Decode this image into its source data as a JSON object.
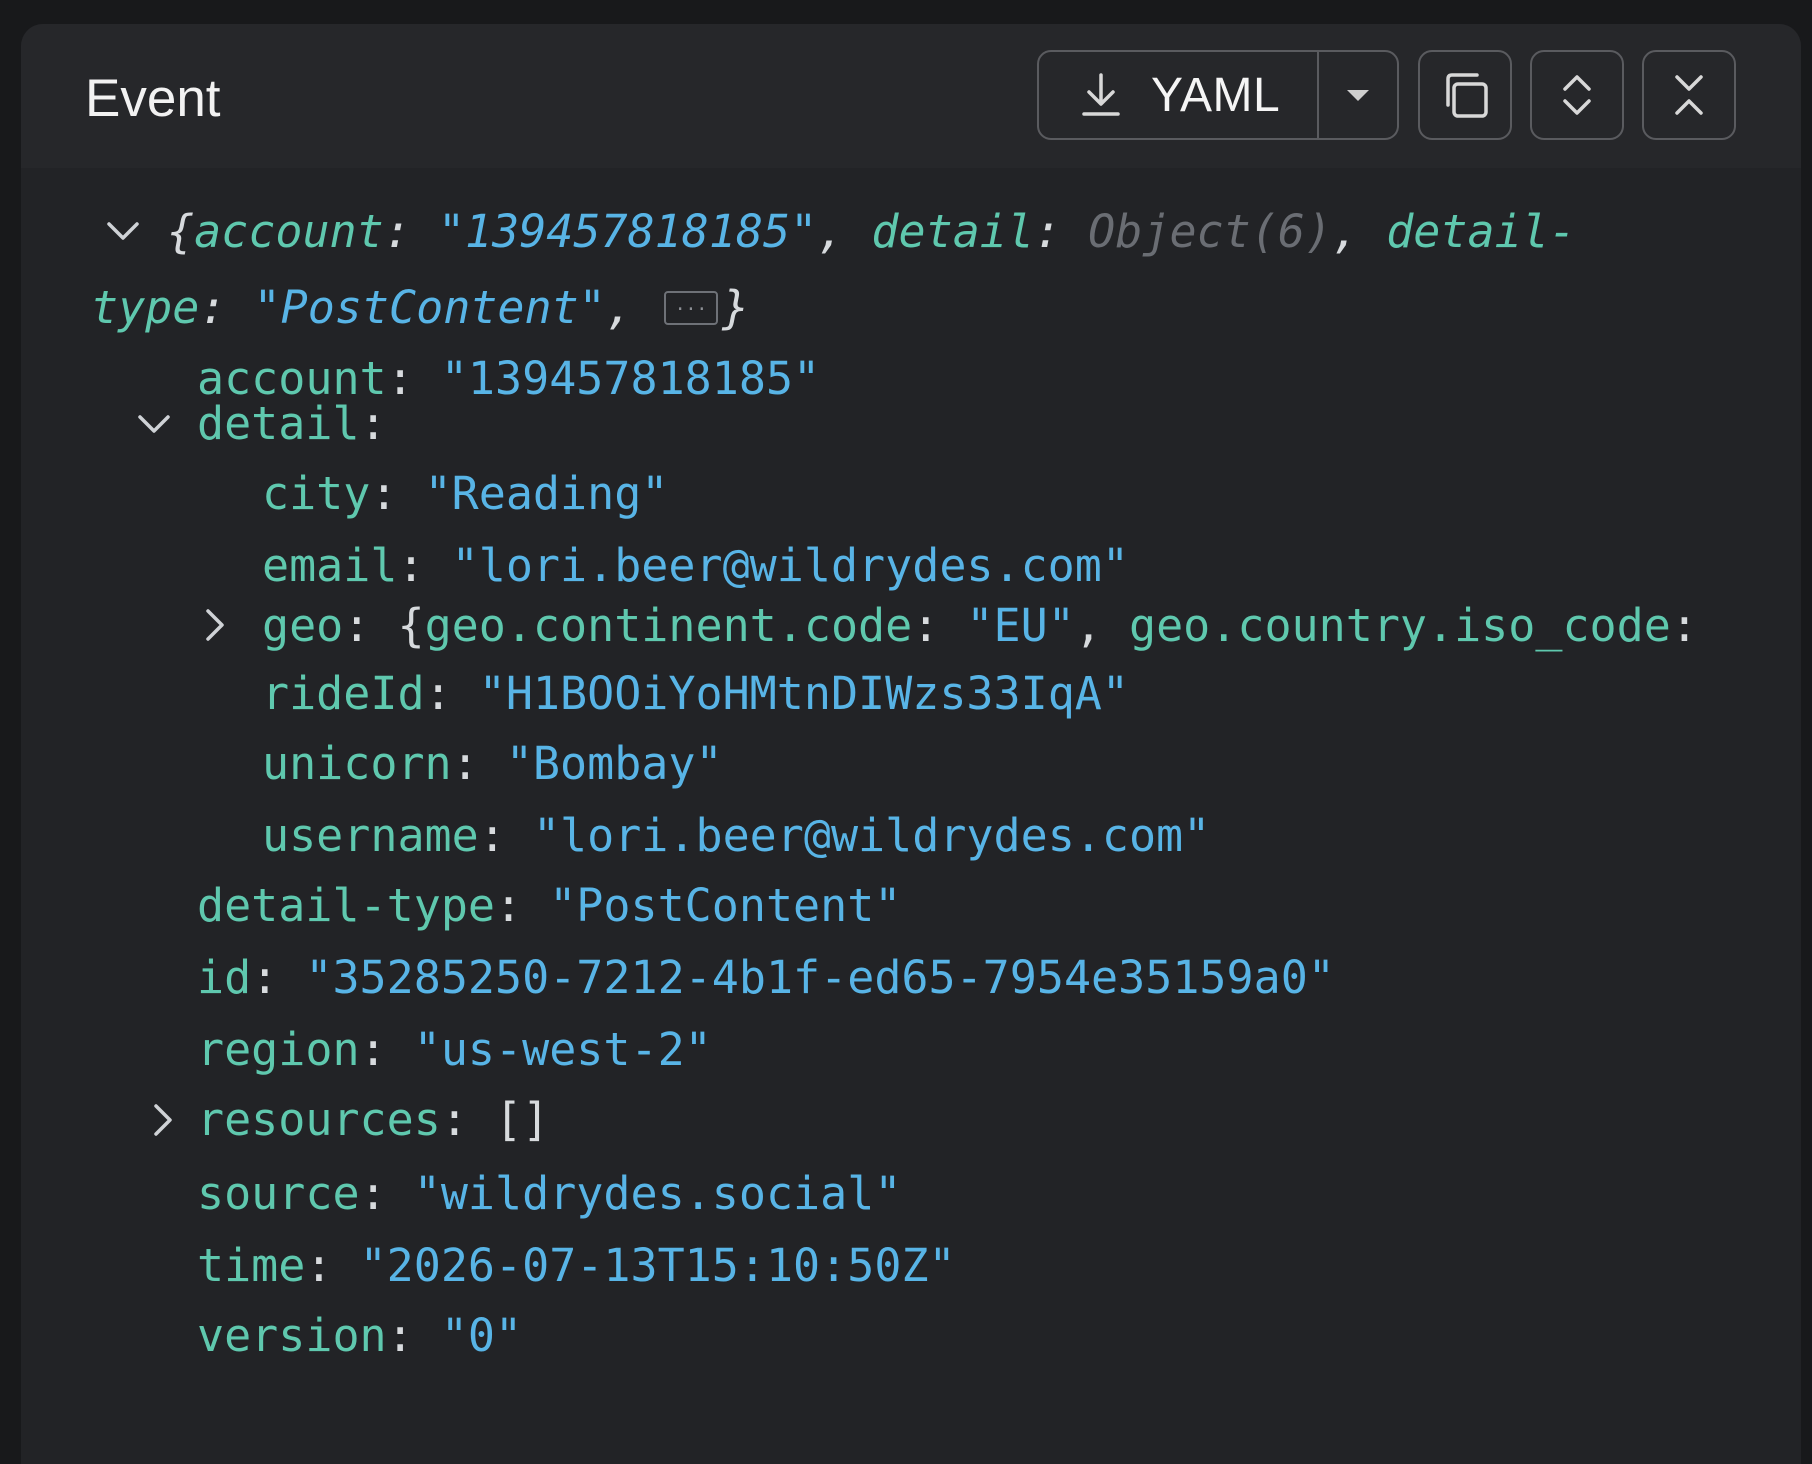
{
  "header": {
    "title": "Event",
    "download_format": "YAML",
    "icons": [
      "download-icon",
      "caret-down-icon",
      "copy-icon",
      "expand-vertical-icon",
      "collapse-vertical-icon"
    ]
  },
  "summary": {
    "k_account": "account",
    "v_account": "\"139457818185\"",
    "k_detail": "detail",
    "v_detail": "Object(6)",
    "k_detail_type_a": "detail-",
    "k_detail_type_b": "type",
    "v_detail_type": "\"PostContent\"",
    "ellipsis": "..."
  },
  "tree": {
    "account": {
      "key": "account",
      "value": "\"139457818185\""
    },
    "detail": {
      "key": "detail"
    },
    "city": {
      "key": "city",
      "value": "\"Reading\""
    },
    "email": {
      "key": "email",
      "value": "\"lori.beer@wildrydes.com\""
    },
    "geo": {
      "key": "geo",
      "k1": "geo.continent.code",
      "v1": "\"EU\"",
      "k2": "geo.country.iso_code"
    },
    "rideId": {
      "key": "rideId",
      "value": "\"H1BOOiYoHMtnDIWzs33IqA\""
    },
    "unicorn": {
      "key": "unicorn",
      "value": "\"Bombay\""
    },
    "username": {
      "key": "username",
      "value": "\"lori.beer@wildrydes.com\""
    },
    "detail_type": {
      "key": "detail-type",
      "value": "\"PostContent\""
    },
    "id": {
      "key": "id",
      "value": "\"35285250-7212-4b1f-ed65-7954e35159a0\""
    },
    "region": {
      "key": "region",
      "value": "\"us-west-2\""
    },
    "resources": {
      "key": "resources",
      "value": "[]"
    },
    "source": {
      "key": "source",
      "value": "\"wildrydes.social\""
    },
    "time": {
      "key": "time",
      "value": "\"2026-07-13T15:10:50Z\""
    },
    "version": {
      "key": "version",
      "value": "\"0\""
    }
  },
  "colors": {
    "key": "#5fc8ae",
    "string": "#58b4e6",
    "punct": "#d7dadd",
    "panel": "#222326",
    "header": "#26272a"
  }
}
